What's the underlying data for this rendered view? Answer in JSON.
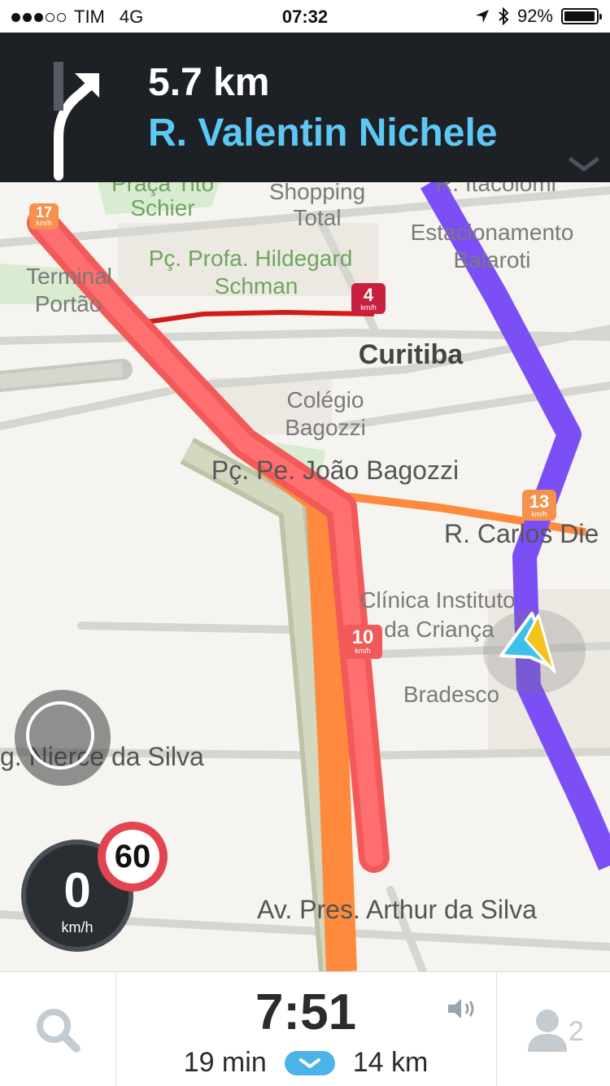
{
  "status_bar": {
    "carrier": "TIM",
    "network": "4G",
    "time": "07:32",
    "battery": "92%",
    "signal_bars_filled": 3,
    "signal_bars_total": 5
  },
  "navigation": {
    "distance": "5.7 km",
    "street": "R. Valentin Nichele",
    "turn_direction": "right"
  },
  "map": {
    "labels": {
      "praca_tito": "Praça Tito",
      "schier": "Schier",
      "shopping": "Shopping",
      "total": "Total",
      "itacolomi": "R. Itacolomi",
      "estacionamento": "Estacionamento",
      "balaroti": "Balaroti",
      "terminal": "Terminal",
      "portao": "Portão",
      "pc_hildegard": "Pç. Profa. Hildegard",
      "schman": "Schman",
      "city": "Curitiba",
      "colegio": "Colégio",
      "bagozzi": "Bagozzi",
      "pc_joao": "Pç. Pe. João Bagozzi",
      "carlos": "R. Carlos Die",
      "clinica": "Clínica Instituto",
      "da_crianca": "da Criança",
      "bradesco": "Bradesco",
      "nierce": "g. Nierce da Silva",
      "arthur": "Av. Pres. Arthur da Silva"
    },
    "traffic_speeds": {
      "tag_a": "17",
      "tag_b": "4",
      "tag_c": "13",
      "tag_d": "10",
      "unit": "km/h"
    }
  },
  "speedometer": {
    "value": "0",
    "unit": "km/h"
  },
  "speed_limit": "60",
  "bottom_bar": {
    "eta": "7:51",
    "duration": "19 min",
    "distance": "14 km",
    "people_count": "2"
  },
  "colors": {
    "route": "#7b4ff5",
    "traffic_heavy": "#f25a5a",
    "traffic_moderate": "#ff8a3d",
    "accent": "#5ec8f5"
  }
}
